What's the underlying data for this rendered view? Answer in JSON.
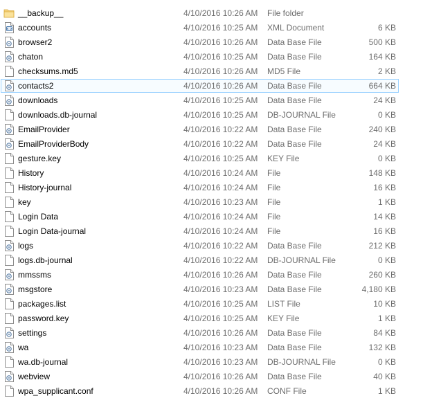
{
  "files": [
    {
      "name": "__backup__",
      "date": "4/10/2016 10:26 AM",
      "type": "File folder",
      "size": "",
      "icon": "folder-icon"
    },
    {
      "name": "accounts",
      "date": "4/10/2016 10:25 AM",
      "type": "XML Document",
      "size": "6 KB",
      "icon": "xml-file-icon"
    },
    {
      "name": "browser2",
      "date": "4/10/2016 10:26 AM",
      "type": "Data Base File",
      "size": "500 KB",
      "icon": "database-file-icon"
    },
    {
      "name": "chaton",
      "date": "4/10/2016 10:25 AM",
      "type": "Data Base File",
      "size": "164 KB",
      "icon": "database-file-icon"
    },
    {
      "name": "checksums.md5",
      "date": "4/10/2016 10:26 AM",
      "type": "MD5 File",
      "size": "2 KB",
      "icon": "blank-file-icon"
    },
    {
      "name": "contacts2",
      "date": "4/10/2016 10:26 AM",
      "type": "Data Base File",
      "size": "664 KB",
      "icon": "database-file-icon",
      "selected": true
    },
    {
      "name": "downloads",
      "date": "4/10/2016 10:25 AM",
      "type": "Data Base File",
      "size": "24 KB",
      "icon": "database-file-icon"
    },
    {
      "name": "downloads.db-journal",
      "date": "4/10/2016 10:25 AM",
      "type": "DB-JOURNAL File",
      "size": "0 KB",
      "icon": "blank-file-icon"
    },
    {
      "name": "EmailProvider",
      "date": "4/10/2016 10:22 AM",
      "type": "Data Base File",
      "size": "240 KB",
      "icon": "database-file-icon"
    },
    {
      "name": "EmailProviderBody",
      "date": "4/10/2016 10:22 AM",
      "type": "Data Base File",
      "size": "24 KB",
      "icon": "database-file-icon"
    },
    {
      "name": "gesture.key",
      "date": "4/10/2016 10:25 AM",
      "type": "KEY File",
      "size": "0 KB",
      "icon": "blank-file-icon"
    },
    {
      "name": "History",
      "date": "4/10/2016 10:24 AM",
      "type": "File",
      "size": "148 KB",
      "icon": "blank-file-icon"
    },
    {
      "name": "History-journal",
      "date": "4/10/2016 10:24 AM",
      "type": "File",
      "size": "16 KB",
      "icon": "blank-file-icon"
    },
    {
      "name": "key",
      "date": "4/10/2016 10:23 AM",
      "type": "File",
      "size": "1 KB",
      "icon": "blank-file-icon"
    },
    {
      "name": "Login Data",
      "date": "4/10/2016 10:24 AM",
      "type": "File",
      "size": "14 KB",
      "icon": "blank-file-icon"
    },
    {
      "name": "Login Data-journal",
      "date": "4/10/2016 10:24 AM",
      "type": "File",
      "size": "16 KB",
      "icon": "blank-file-icon"
    },
    {
      "name": "logs",
      "date": "4/10/2016 10:22 AM",
      "type": "Data Base File",
      "size": "212 KB",
      "icon": "database-file-icon"
    },
    {
      "name": "logs.db-journal",
      "date": "4/10/2016 10:22 AM",
      "type": "DB-JOURNAL File",
      "size": "0 KB",
      "icon": "blank-file-icon"
    },
    {
      "name": "mmssms",
      "date": "4/10/2016 10:26 AM",
      "type": "Data Base File",
      "size": "260 KB",
      "icon": "database-file-icon"
    },
    {
      "name": "msgstore",
      "date": "4/10/2016 10:23 AM",
      "type": "Data Base File",
      "size": "4,180 KB",
      "icon": "database-file-icon"
    },
    {
      "name": "packages.list",
      "date": "4/10/2016 10:25 AM",
      "type": "LIST File",
      "size": "10 KB",
      "icon": "blank-file-icon"
    },
    {
      "name": "password.key",
      "date": "4/10/2016 10:25 AM",
      "type": "KEY File",
      "size": "1 KB",
      "icon": "blank-file-icon"
    },
    {
      "name": "settings",
      "date": "4/10/2016 10:26 AM",
      "type": "Data Base File",
      "size": "84 KB",
      "icon": "database-file-icon"
    },
    {
      "name": "wa",
      "date": "4/10/2016 10:23 AM",
      "type": "Data Base File",
      "size": "132 KB",
      "icon": "database-file-icon"
    },
    {
      "name": "wa.db-journal",
      "date": "4/10/2016 10:23 AM",
      "type": "DB-JOURNAL File",
      "size": "0 KB",
      "icon": "blank-file-icon"
    },
    {
      "name": "webview",
      "date": "4/10/2016 10:26 AM",
      "type": "Data Base File",
      "size": "40 KB",
      "icon": "database-file-icon"
    },
    {
      "name": "wpa_supplicant.conf",
      "date": "4/10/2016 10:26 AM",
      "type": "CONF File",
      "size": "1 KB",
      "icon": "blank-file-icon"
    }
  ]
}
